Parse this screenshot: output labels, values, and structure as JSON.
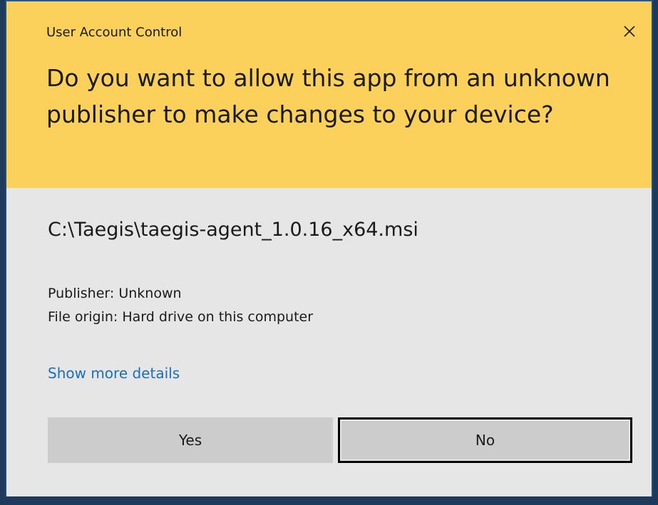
{
  "dialog": {
    "title": "User Account Control",
    "question": "Do you want to allow this app from an unknown publisher to make changes to your device?",
    "program_path": "C:\\Taegis\\taegis-agent_1.0.16_x64.msi",
    "publisher": "Publisher: Unknown",
    "file_origin": "File origin: Hard drive on this computer",
    "show_more_details": "Show more details",
    "yes_label": "Yes",
    "no_label": "No"
  },
  "colors": {
    "banner": "#fcd15b",
    "body": "#e6e6e6",
    "link": "#1c6fb8",
    "button": "#cccccc"
  },
  "icons": {
    "close": "close-icon"
  }
}
